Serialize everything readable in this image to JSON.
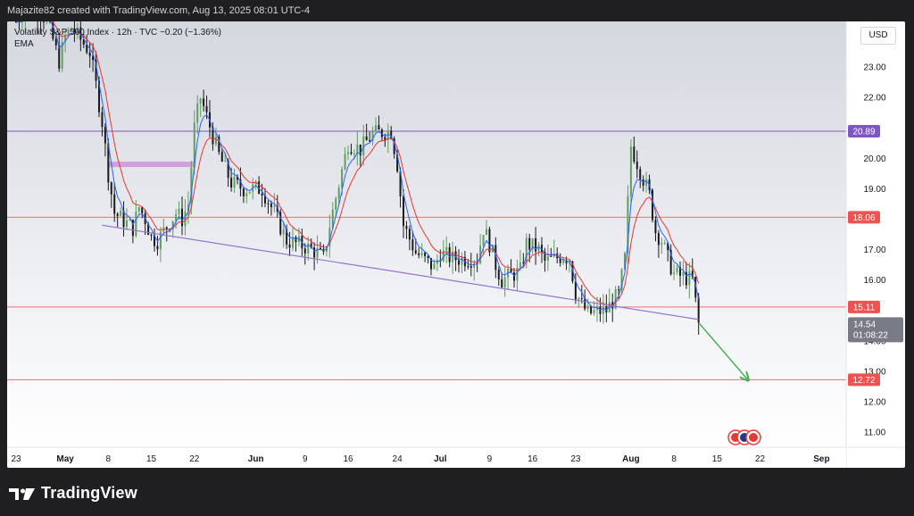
{
  "header": {
    "attribution": "Majazite82 created with TradingView.com, Aug 13, 2025 08:01 UTC-4"
  },
  "legend": {
    "symbol_line": "Volatility S&P 500 Index · 12h · TVC",
    "change": "−0.20 (−1.36%)",
    "indicator": "EMA"
  },
  "toolbar": {
    "currency_label": "USD"
  },
  "footer": {
    "brand": "TradingView"
  },
  "colors": {
    "background": "#ffffff",
    "gradient_top": "#d6d8e0",
    "candle_up": "#5f9f5f",
    "candle_down": "#1a1a1a",
    "ema_fast": "#2962ff",
    "ema_slow": "#e53935",
    "hline_red": "#e57373",
    "hline_purple": "#7e57c2",
    "trendline": "#9575cd",
    "zone": "#ce93d8",
    "arrow": "#4caf50",
    "badge_red": "#ef5350",
    "badge_purple": "#7e57c2",
    "badge_price": "#787b86"
  },
  "chart_data": {
    "type": "candlestick",
    "ylim": [
      10.5,
      24.5
    ],
    "price_axis_ticks": [
      "11.00",
      "12.00",
      "13.00",
      "14.00",
      "16.00",
      "17.00",
      "19.00",
      "20.00",
      "22.00",
      "23.00"
    ],
    "time_axis_labels": [
      "23",
      "May",
      "8",
      "15",
      "22",
      "Jun",
      "9",
      "16",
      "24",
      "Jul",
      "9",
      "16",
      "23",
      "Aug",
      "8",
      "15",
      "22",
      "Sep"
    ],
    "horizontal_levels": [
      {
        "value": 20.89,
        "label": "20.89",
        "color": "purple"
      },
      {
        "value": 18.06,
        "label": "18.06",
        "color": "red"
      },
      {
        "value": 15.11,
        "label": "15.11",
        "color": "red"
      },
      {
        "value": 12.72,
        "label": "12.72",
        "color": "red"
      }
    ],
    "last_price": {
      "value": 14.54,
      "label": "14.54",
      "countdown": "01:08:22"
    },
    "resistance_zone": {
      "start": "May 8",
      "end": "May 22",
      "value": 19.8
    },
    "trendline": {
      "start": {
        "date": "May 7",
        "value": 17.8
      },
      "end": {
        "date": "Aug 12",
        "value": 14.7
      }
    },
    "projection_arrow": {
      "start": {
        "date": "Aug 12",
        "value": 14.6
      },
      "end": {
        "date": "Aug 20",
        "value": 12.72
      }
    },
    "close_path": [
      {
        "date": "Apr 23",
        "value": 24.5
      },
      {
        "date": "Apr 25",
        "value": 25.0
      },
      {
        "date": "Apr 28",
        "value": 24.6
      },
      {
        "date": "Apr 30",
        "value": 23.2
      },
      {
        "date": "May 1",
        "value": 24.0
      },
      {
        "date": "May 2",
        "value": 24.3
      },
      {
        "date": "May 5",
        "value": 23.5
      },
      {
        "date": "May 6",
        "value": 22.4
      },
      {
        "date": "May 7",
        "value": 21.2
      },
      {
        "date": "May 8",
        "value": 19.5
      },
      {
        "date": "May 9",
        "value": 18.2
      },
      {
        "date": "May 12",
        "value": 17.7
      },
      {
        "date": "May 13",
        "value": 18.4
      },
      {
        "date": "May 14",
        "value": 18.0
      },
      {
        "date": "May 15",
        "value": 17.4
      },
      {
        "date": "May 16",
        "value": 17.3
      },
      {
        "date": "May 19",
        "value": 18.2
      },
      {
        "date": "May 20",
        "value": 18.0
      },
      {
        "date": "May 21",
        "value": 18.5
      },
      {
        "date": "May 22",
        "value": 21.0
      },
      {
        "date": "May 23",
        "value": 22.0
      },
      {
        "date": "May 26",
        "value": 20.1
      },
      {
        "date": "May 28",
        "value": 19.2
      },
      {
        "date": "May 30",
        "value": 19.0
      },
      {
        "date": "Jun 2",
        "value": 19.0
      },
      {
        "date": "Jun 4",
        "value": 18.2
      },
      {
        "date": "Jun 6",
        "value": 17.3
      },
      {
        "date": "Jun 9",
        "value": 17.1
      },
      {
        "date": "Jun 11",
        "value": 16.9
      },
      {
        "date": "Jun 12",
        "value": 16.7
      },
      {
        "date": "Jun 13",
        "value": 17.8
      },
      {
        "date": "Jun 16",
        "value": 20.5
      },
      {
        "date": "Jun 18",
        "value": 20.3
      },
      {
        "date": "Jun 20",
        "value": 20.8
      },
      {
        "date": "Jun 23",
        "value": 20.9
      },
      {
        "date": "Jun 24",
        "value": 19.8
      },
      {
        "date": "Jun 25",
        "value": 17.8
      },
      {
        "date": "Jun 27",
        "value": 16.9
      },
      {
        "date": "Jun 30",
        "value": 16.4
      },
      {
        "date": "Jul 1",
        "value": 16.9
      },
      {
        "date": "Jul 3",
        "value": 16.7
      },
      {
        "date": "Jul 7",
        "value": 16.7
      },
      {
        "date": "Jul 8",
        "value": 17.7
      },
      {
        "date": "Jul 9",
        "value": 17.2
      },
      {
        "date": "Jul 10",
        "value": 16.5
      },
      {
        "date": "Jul 11",
        "value": 16.0
      },
      {
        "date": "Jul 14",
        "value": 16.3
      },
      {
        "date": "Jul 15",
        "value": 17.2
      },
      {
        "date": "Jul 16",
        "value": 17.1
      },
      {
        "date": "Jul 17",
        "value": 17.0
      },
      {
        "date": "Jul 18",
        "value": 16.6
      },
      {
        "date": "Jul 21",
        "value": 16.8
      },
      {
        "date": "Jul 22",
        "value": 16.7
      },
      {
        "date": "Jul 23",
        "value": 15.6
      },
      {
        "date": "Jul 24",
        "value": 15.2
      },
      {
        "date": "Jul 25",
        "value": 14.9
      },
      {
        "date": "Jul 28",
        "value": 15.0
      },
      {
        "date": "Jul 29",
        "value": 15.3
      },
      {
        "date": "Jul 30",
        "value": 15.5
      },
      {
        "date": "Jul 31",
        "value": 16.7
      },
      {
        "date": "Aug 1",
        "value": 20.4
      },
      {
        "date": "Aug 4",
        "value": 18.8
      },
      {
        "date": "Aug 5",
        "value": 17.6
      },
      {
        "date": "Aug 6",
        "value": 17.3
      },
      {
        "date": "Aug 7",
        "value": 16.7
      },
      {
        "date": "Aug 8",
        "value": 16.2
      },
      {
        "date": "Aug 11",
        "value": 16.0
      },
      {
        "date": "Aug 12",
        "value": 14.54
      }
    ]
  }
}
